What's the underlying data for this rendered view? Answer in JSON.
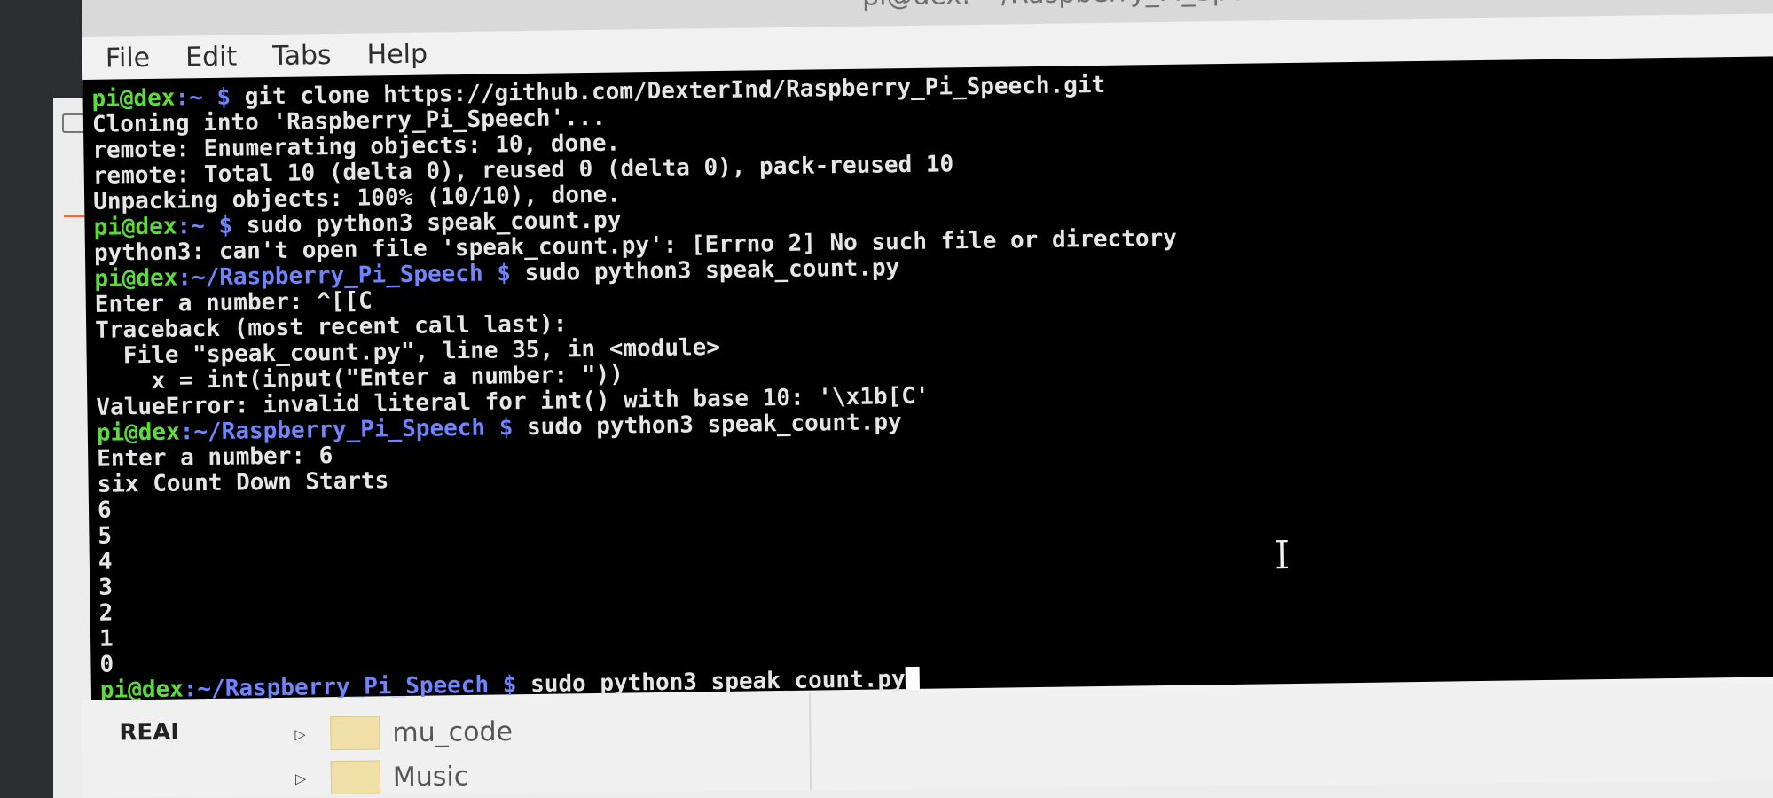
{
  "window": {
    "title": "pi@dex: ~/Raspberry_Pi_Speech"
  },
  "menu": [
    "File",
    "Edit",
    "Tabs",
    "Help"
  ],
  "terminal": {
    "prompt_user": "pi@dex",
    "lines": [
      {
        "type": "cmd",
        "path": ":~ $ ",
        "cmd": "git clone https://github.com/DexterInd/Raspberry_Pi_Speech.git"
      },
      {
        "type": "out",
        "text": "Cloning into 'Raspberry_Pi_Speech'..."
      },
      {
        "type": "out",
        "text": "remote: Enumerating objects: 10, done."
      },
      {
        "type": "out",
        "text": "remote: Total 10 (delta 0), reused 0 (delta 0), pack-reused 10"
      },
      {
        "type": "out",
        "text": "Unpacking objects: 100% (10/10), done."
      },
      {
        "type": "cmd",
        "path": ":~ $ ",
        "cmd": "sudo python3 speak_count.py"
      },
      {
        "type": "out",
        "text": "python3: can't open file 'speak_count.py': [Errno 2] No such file or directory"
      },
      {
        "type": "cmd",
        "path": ":~/Raspberry_Pi_Speech $ ",
        "cmd": "sudo python3 speak_count.py"
      },
      {
        "type": "out",
        "text": "Enter a number: ^[[C"
      },
      {
        "type": "out",
        "text": "Traceback (most recent call last):"
      },
      {
        "type": "out",
        "text": "  File \"speak_count.py\", line 35, in <module>"
      },
      {
        "type": "out",
        "text": "    x = int(input(\"Enter a number: \"))"
      },
      {
        "type": "out",
        "text": "ValueError: invalid literal for int() with base 10: '\\x1b[C'"
      },
      {
        "type": "cmd",
        "path": ":~/Raspberry_Pi_Speech $ ",
        "cmd": "sudo python3 speak_count.py"
      },
      {
        "type": "out",
        "text": "Enter a number: 6"
      },
      {
        "type": "out",
        "text": "six Count Down Starts"
      },
      {
        "type": "out",
        "text": "6"
      },
      {
        "type": "out",
        "text": "5"
      },
      {
        "type": "out",
        "text": "4"
      },
      {
        "type": "out",
        "text": "3"
      },
      {
        "type": "out",
        "text": "2"
      },
      {
        "type": "out",
        "text": "1"
      },
      {
        "type": "out",
        "text": "0"
      },
      {
        "type": "cmd-active",
        "path": ":~/Raspberry_Pi_Speech $ ",
        "cmd": "sudo python3 speak_count.py"
      }
    ]
  },
  "file_manager": {
    "side_label": "REAI",
    "items": [
      "mu_code",
      "Music"
    ]
  },
  "colors": {
    "prompt_user": "#5cdc3a",
    "prompt_path": "#6f84ff",
    "terminal_bg": "#000000",
    "terminal_fg": "#e6e6e6"
  }
}
